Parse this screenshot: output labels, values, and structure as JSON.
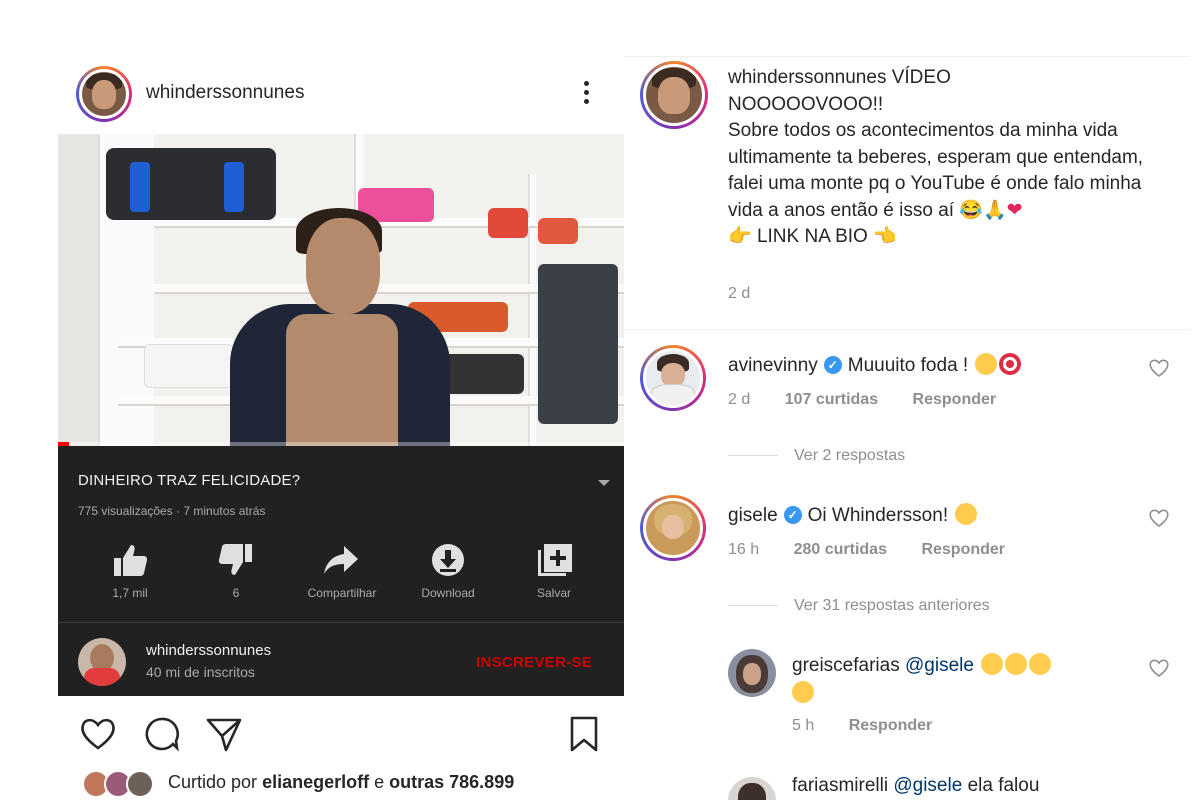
{
  "post": {
    "username": "whinderssonnunes",
    "liked_by_prefix": "Curtido por",
    "liked_by_user": "elianegerloff",
    "liked_by_connector": "e",
    "liked_by_others": "outras 786.899"
  },
  "youtube": {
    "title": "DINHEIRO TRAZ FELICIDADE?",
    "meta": "775 visualizações · 7 minutos atrás",
    "progress_fraction": 0.02,
    "actions": [
      {
        "label": "1,7 mil",
        "icon": "thumbs-up-icon"
      },
      {
        "label": "6",
        "icon": "thumbs-down-icon"
      },
      {
        "label": "Compartilhar",
        "icon": "share-icon"
      },
      {
        "label": "Download",
        "icon": "download-icon"
      },
      {
        "label": "Salvar",
        "icon": "save-to-playlist-icon"
      }
    ],
    "channel_name": "whinderssonnunes",
    "channel_subs": "40 mi de inscritos",
    "subscribe_label": "INSCREVER-SE"
  },
  "caption": {
    "username": "whinderssonnunes",
    "text_line1": "VÍDEO",
    "text_line2": "NOOOOOVOOO!!",
    "text_body": "Sobre todos os acontecimentos da minha vida ultimamente ta beberes, esperam que entendam, falei uma monte pq o YouTube é onde falo minha vida a anos então é isso aí",
    "link_text": "LINK NA BIO",
    "time": "2 d"
  },
  "comments": [
    {
      "username": "avinevinny",
      "verified": true,
      "text": "Muuuito foda !",
      "time": "2 d",
      "likes": "107 curtidas",
      "reply": "Responder",
      "view_replies": "Ver 2 respostas"
    },
    {
      "username": "gisele",
      "verified": true,
      "text": "Oi Whindersson!",
      "time": "16 h",
      "likes": "280 curtidas",
      "reply": "Responder",
      "view_replies": "Ver 31 respostas anteriores"
    }
  ],
  "replies": [
    {
      "username": "greiscefarias",
      "mention": "@gisele",
      "text": "",
      "time": "5 h",
      "reply": "Responder"
    },
    {
      "username": "fariasmirelli",
      "mention": "@gisele",
      "text": "ela falou",
      "time": "",
      "reply": ""
    }
  ],
  "colors": {
    "youtube_bg": "#212121",
    "subscribe_red": "#cc0000",
    "verified_blue": "#3897f0",
    "text_primary": "#262626",
    "text_secondary": "#8e8e8e"
  }
}
